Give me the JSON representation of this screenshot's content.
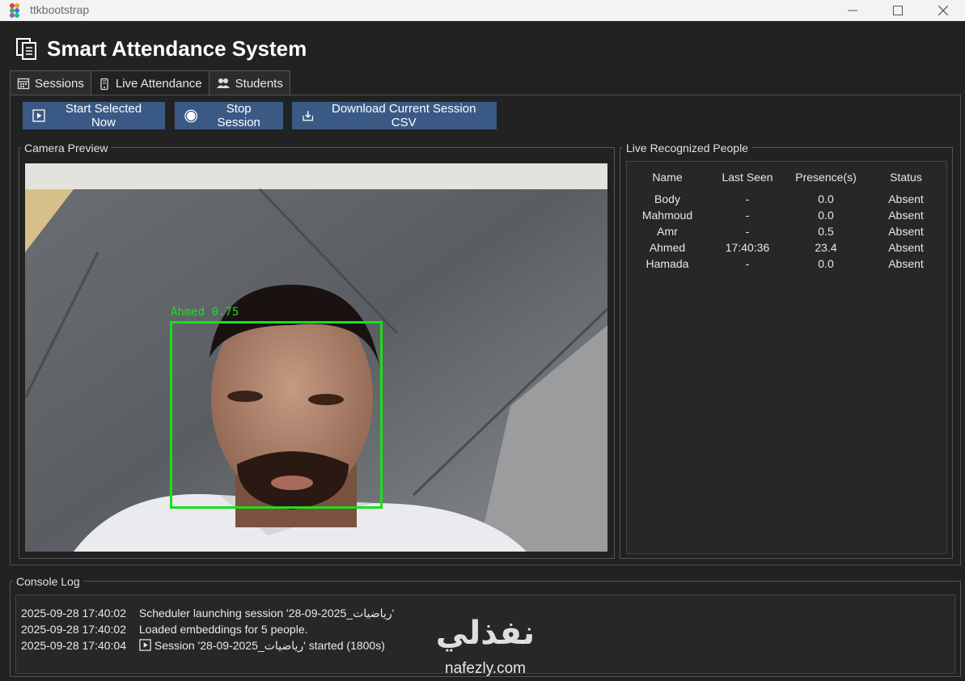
{
  "window": {
    "title": "ttkbootstrap"
  },
  "header": {
    "title": "Smart Attendance System"
  },
  "tabs": [
    {
      "label": "Sessions",
      "icon": "calendar-icon"
    },
    {
      "label": "Live Attendance",
      "icon": "phone-icon"
    },
    {
      "label": "Students",
      "icon": "users-icon"
    }
  ],
  "toolbar": {
    "start_label": "Start Selected Now",
    "stop_label": "Stop Session",
    "download_label": "Download Current Session CSV"
  },
  "camera": {
    "group_label": "Camera Preview",
    "detection_label": "Ahmed 0.75",
    "box_color": "#19e019"
  },
  "recognized": {
    "group_label": "Live Recognized People",
    "columns": [
      "Name",
      "Last Seen",
      "Presence(s)",
      "Status"
    ],
    "rows": [
      {
        "name": "Body",
        "last_seen": "-",
        "presence": "0.0",
        "status": "Absent"
      },
      {
        "name": "Mahmoud",
        "last_seen": "-",
        "presence": "0.0",
        "status": "Absent"
      },
      {
        "name": "Amr",
        "last_seen": "-",
        "presence": "0.5",
        "status": "Absent"
      },
      {
        "name": "Ahmed",
        "last_seen": "17:40:36",
        "presence": "23.4",
        "status": "Absent"
      },
      {
        "name": "Hamada",
        "last_seen": "-",
        "presence": "0.0",
        "status": "Absent"
      }
    ]
  },
  "console": {
    "group_label": "Console Log",
    "lines": [
      {
        "ts": "2025-09-28 17:40:02",
        "msg": "Scheduler launching session '28-09-2025_رياضيات'"
      },
      {
        "ts": "2025-09-28 17:40:02",
        "msg": "Loaded embeddings for 5 people."
      },
      {
        "ts": "2025-09-28 17:40:04",
        "msg": "Session '28-09-2025_رياضيات' started (1800s)"
      }
    ]
  },
  "watermark": {
    "arabic": "نفذلي",
    "latin": "nafezly.com"
  },
  "colors": {
    "accent": "#3a5a85",
    "background": "#222222"
  }
}
